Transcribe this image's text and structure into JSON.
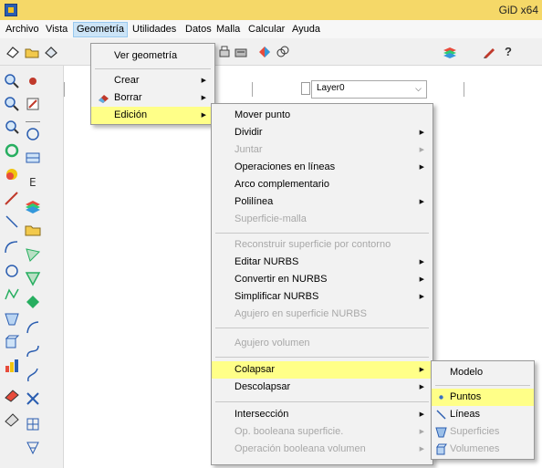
{
  "window": {
    "title": "GiD x64"
  },
  "menubar": [
    "Archivo",
    "Vista",
    "Geometría",
    "Utilidades",
    "Datos",
    "Malla",
    "Calcular",
    "Ayuda"
  ],
  "toolbar": {
    "layer_value": "Layer0"
  },
  "geometry_menu": {
    "items": [
      "Ver geometría",
      "Crear",
      "Borrar",
      "Edición"
    ],
    "highlighted": "Edición"
  },
  "edicion_menu": {
    "items": [
      {
        "label": "Mover punto",
        "enabled": true
      },
      {
        "label": "Dividir",
        "enabled": true,
        "submenu": true
      },
      {
        "label": "Juntar",
        "enabled": false,
        "submenu": true
      },
      {
        "label": "Operaciones en líneas",
        "enabled": true,
        "submenu": true
      },
      {
        "label": "Arco complementario",
        "enabled": true
      },
      {
        "label": "Polilínea",
        "enabled": true,
        "submenu": true
      },
      {
        "label": "Superficie-malla",
        "enabled": false
      },
      {
        "label": "Reconstruir superficie por contorno",
        "enabled": false
      },
      {
        "label": "Editar NURBS",
        "enabled": true,
        "submenu": true
      },
      {
        "label": "Convertir en NURBS",
        "enabled": true,
        "submenu": true
      },
      {
        "label": "Simplificar NURBS",
        "enabled": true,
        "submenu": true
      },
      {
        "label": "Agujero en superficie NURBS",
        "enabled": false
      },
      {
        "label": "Agujero volumen",
        "enabled": false
      },
      {
        "label": "Colapsar",
        "enabled": true,
        "submenu": true
      },
      {
        "label": "Descolapsar",
        "enabled": true,
        "submenu": true
      },
      {
        "label": "Intersección",
        "enabled": true,
        "submenu": true
      },
      {
        "label": "Op. booleana superficie.",
        "enabled": false,
        "submenu": true
      },
      {
        "label": "Operación booleana volumen",
        "enabled": false,
        "submenu": true
      }
    ],
    "highlighted": "Colapsar"
  },
  "colapsar_menu": {
    "items": [
      {
        "label": "Modelo",
        "enabled": true
      },
      {
        "label": "Puntos",
        "enabled": true
      },
      {
        "label": "Líneas",
        "enabled": true
      },
      {
        "label": "Superficies",
        "enabled": false
      },
      {
        "label": "Volumenes",
        "enabled": false
      }
    ],
    "highlighted": "Puntos"
  },
  "colors": {
    "titlebar": "#f5d868",
    "menu_highlight": "#ffff88",
    "disabled_text": "#a8a8a8"
  }
}
